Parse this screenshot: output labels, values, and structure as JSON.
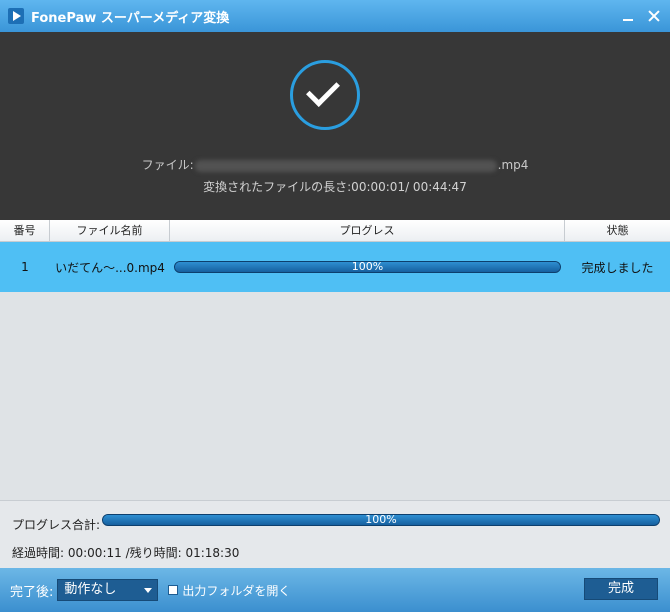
{
  "window": {
    "title": "FonePaw スーパーメディア変換"
  },
  "header": {
    "file_label": "ファイル:",
    "file_suffix": ".mp4",
    "duration_label": "変換されたファイルの長さ:00:00:01/ 00:44:47"
  },
  "table": {
    "columns": [
      "番号",
      "ファイル名前",
      "プログレス",
      "状態"
    ],
    "rows": [
      {
        "index": "1",
        "filename": "いだてん～...0.mp4",
        "progress": 1.0,
        "progress_text": "100%",
        "status": "完成しました"
      }
    ]
  },
  "summary": {
    "total_label": "プログレス合計:",
    "total_progress": 1.0,
    "total_progress_text": "100%",
    "time_text": "経過時間: 00:00:11 /残り時間: 01:18:30"
  },
  "footer": {
    "after_label": "完了後:",
    "after_value": "動作なし",
    "open_folder_label": "出力フォルダを開く",
    "done_label": "完成"
  },
  "colors": {
    "accent": "#3a95d8",
    "row_selected": "#4fbff4",
    "progress": "#1a6aa8"
  }
}
